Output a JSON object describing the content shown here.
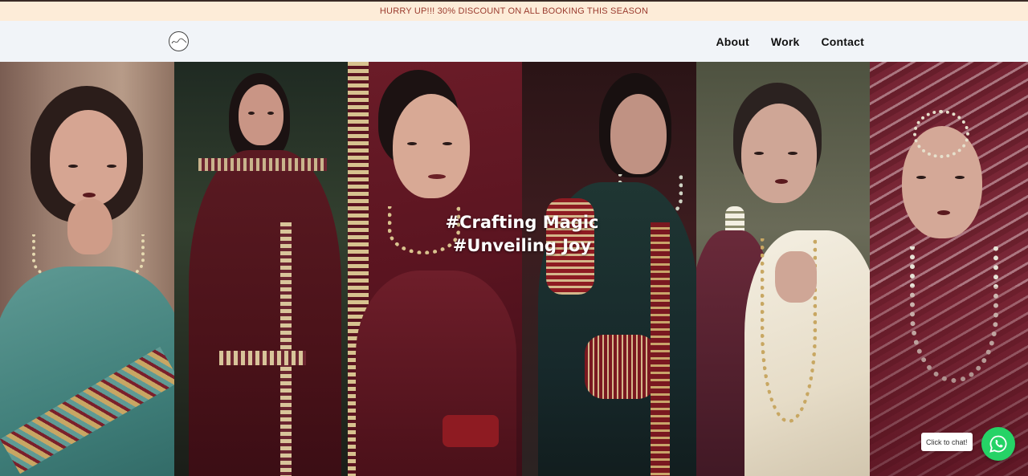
{
  "promo": {
    "text": "HURRY UP!!! 30% DISCOUNT ON ALL BOOKING THIS SEASON"
  },
  "header": {
    "nav": [
      {
        "label": "About"
      },
      {
        "label": "Work"
      },
      {
        "label": "Contact"
      }
    ]
  },
  "hero": {
    "line1": "#Crafting Magic",
    "line2": "#Unveiling Joy",
    "photos": [
      {
        "alt": "bride-teal-saree"
      },
      {
        "alt": "bride-maroon-suit"
      },
      {
        "alt": "bride-maroon-lehenga-smiling"
      },
      {
        "alt": "bride-dark-green-bangles"
      },
      {
        "alt": "bride-white-saree"
      },
      {
        "alt": "bride-pink-dupatta"
      }
    ]
  },
  "chat": {
    "tooltip": "Click to chat!",
    "icon": "whatsapp-icon",
    "color": "#25d366"
  },
  "colors": {
    "promo_bg": "#fdecd8",
    "promo_text": "#9a3b2e",
    "header_bg": "#f1f4f8"
  }
}
